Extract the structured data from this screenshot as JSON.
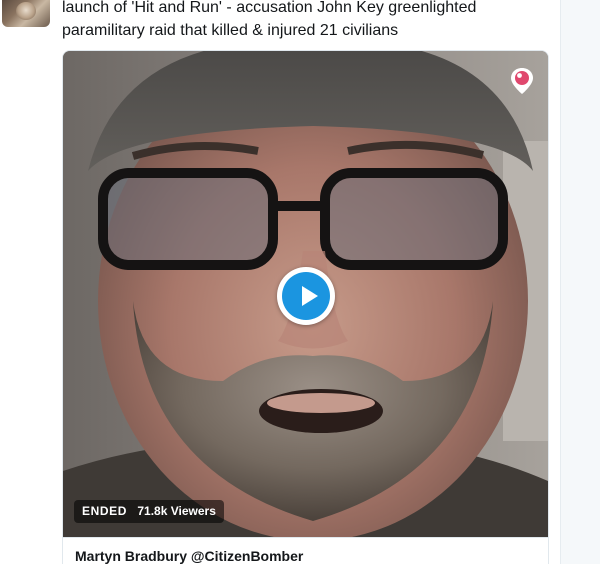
{
  "tweet": {
    "text_line1": "launch of 'Hit and Run' - accusation John Key greenlighted",
    "text_line2": "paramilitary raid that killed & injured 21 civilians"
  },
  "media": {
    "status_label": "ENDED",
    "viewers_label": "71.8k Viewers",
    "author_label": "Martyn Bradbury @CitizenBomber",
    "play_icon": "play-icon",
    "badge_icon": "periscope-icon"
  },
  "colors": {
    "accent": "#1b95e0",
    "text": "#14171a",
    "border": "#e1e8ed",
    "periscope": "#e0486e"
  }
}
